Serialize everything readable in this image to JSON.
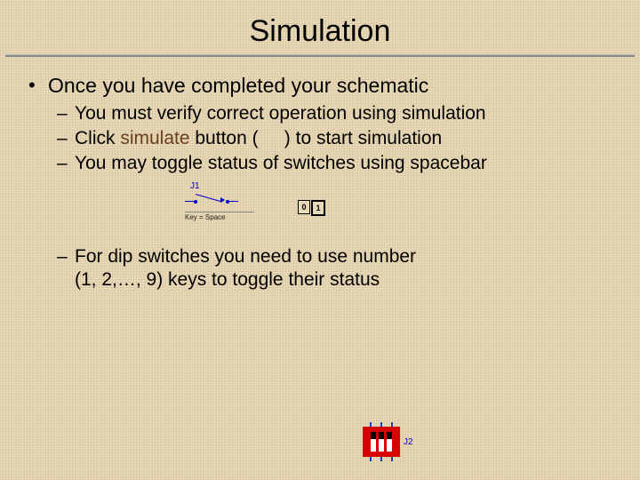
{
  "title": "Simulation",
  "bullets": {
    "b1": "Once you have completed your schematic",
    "b2a": "You must verify correct operation using simulation",
    "b2b_pre": "Click ",
    "b2b_word": "simulate",
    "b2b_mid": " button (",
    "b2b_post": ") to start simulation",
    "b2c": "You may toggle status of switches using spacebar",
    "b2d_line1": "For dip switches you need to use number",
    "b2d_line2": "(1, 2,…, 9) keys to toggle their status"
  },
  "icons": {
    "sim0": "0",
    "sim1": "1"
  },
  "switch_fig": {
    "label": "J1",
    "caption": "Key = Space"
  },
  "dip_fig": {
    "label": "J2"
  }
}
